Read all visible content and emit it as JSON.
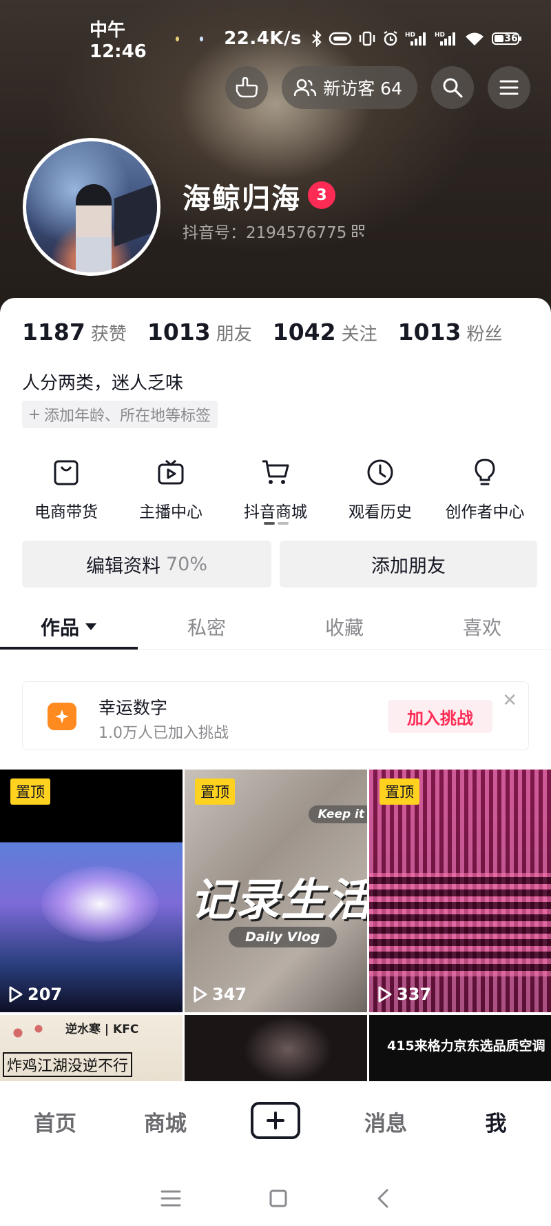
{
  "status_bar": {
    "time": "中午12:46",
    "network_speed": "22.4K/s",
    "battery": "36"
  },
  "header": {
    "visitor_label": "新访客 64",
    "icons": [
      "gesture-icon",
      "visitors-icon",
      "search-icon",
      "menu-icon"
    ]
  },
  "profile": {
    "name": "海鲸归海",
    "level": "3",
    "douyin_id": "抖音号：2194576775"
  },
  "stats": [
    {
      "num": "1187",
      "label": "获赞"
    },
    {
      "num": "1013",
      "label": "朋友"
    },
    {
      "num": "1042",
      "label": "关注"
    },
    {
      "num": "1013",
      "label": "粉丝"
    }
  ],
  "bio": "人分两类，迷人乏味",
  "tag_chip": "添加年龄、所在地等标签",
  "shortcuts": [
    {
      "label": "电商带货",
      "icon": "shopping-bag-icon"
    },
    {
      "label": "主播中心",
      "icon": "tv-icon"
    },
    {
      "label": "抖音商城",
      "icon": "cart-icon"
    },
    {
      "label": "观看历史",
      "icon": "clock-icon"
    },
    {
      "label": "创作者中心",
      "icon": "lightbulb-icon"
    }
  ],
  "buttons": {
    "edit_profile": "编辑资料",
    "edit_percent": "70%",
    "add_friend": "添加朋友"
  },
  "tabs": [
    "作品",
    "私密",
    "收藏",
    "喜欢"
  ],
  "challenge": {
    "title": "幸运数字",
    "subtitle": "1.0万人已加入挑战",
    "join_label": "加入挑战"
  },
  "videos": [
    {
      "pin": "置顶",
      "plays": "207"
    },
    {
      "pin": "置顶",
      "plays": "347",
      "overlay_big": "记录生活",
      "overlay_small": "Daily Vlog",
      "overlay_top": "Keep it"
    },
    {
      "pin": "置顶",
      "plays": "337"
    },
    {
      "overlay_top": "逆水寒 | KFC",
      "overlay_big": "炸鸡江湖没逆不行"
    },
    {},
    {
      "overlay_big": "415来格力京东选品质空调"
    }
  ],
  "bottom_nav": {
    "home": "首页",
    "mall": "商城",
    "messages": "消息",
    "me": "我"
  }
}
